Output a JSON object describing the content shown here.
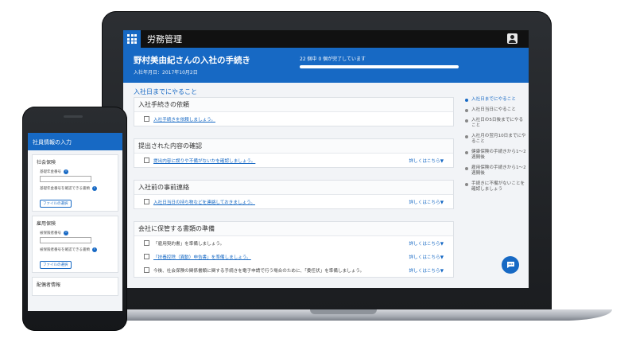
{
  "laptop": {
    "app_title": "労務管理",
    "banner_title": "野村美由紀さんの入社の手続き",
    "banner_subtitle": "入社年月日：2017年10月2日",
    "progress_text": "22 個中 0 個が完了しています",
    "progress_fraction": 1.0,
    "section_link": "入社日までにやること",
    "groups": [
      {
        "title": "入社手続きの依頼",
        "tasks": [
          {
            "text": "入社手続きを依頼しましょう。",
            "link": true,
            "detail": ""
          }
        ]
      },
      {
        "title": "提出された内容の確認",
        "tasks": [
          {
            "text": "提出内容に誤りや不備がないかを確認しましょう。",
            "link": true,
            "detail": "詳しくはこちら▼"
          }
        ]
      },
      {
        "title": "入社前の事前連絡",
        "tasks": [
          {
            "text": "入社日当日の持ち物などを連絡しておきましょう。",
            "link": true,
            "detail": "詳しくはこちら▼"
          }
        ]
      },
      {
        "title": "会社に保管する書類の準備",
        "tasks": [
          {
            "text": "「雇用契約書」を準備しましょう。",
            "link": false,
            "detail": "詳しくはこちら▼"
          },
          {
            "text": "「扶養控除（異動）申告書」を準備しましょう。",
            "link": true,
            "detail": "詳しくはこちら▼"
          },
          {
            "text": "今後、社会保険の関係書類に関する手続きを電子申請で行う場合のために、「委任状」を準備しましょう。",
            "link": false,
            "detail": "詳しくはこちら▼"
          }
        ]
      }
    ],
    "steps": [
      {
        "label": "入社日までにやること",
        "active": true
      },
      {
        "label": "入社日当日にやること",
        "active": false
      },
      {
        "label": "入社日の5日後までにやること",
        "active": false
      },
      {
        "label": "入社月の翌月10日までにやること",
        "active": false
      },
      {
        "label": "健康保険の手続きから1〜2週間後",
        "active": false
      },
      {
        "label": "雇用保険の手続きから1〜2週間後",
        "active": false
      },
      {
        "label": "手続きに不備がないことを確認しましょう",
        "active": false
      }
    ]
  },
  "phone": {
    "header_title": "社員情報の入力",
    "cards": [
      {
        "title": "社会保険",
        "fields": [
          "基礎年金番号",
          "基礎年金番号を確認できる書類"
        ],
        "file_button": "ファイルの選択"
      },
      {
        "title": "雇用保険",
        "fields": [
          "被保険者番号",
          "被保険者番号を確認できる書類"
        ],
        "file_button": "ファイルの選択"
      },
      {
        "title": "配偶者情報",
        "fields": [],
        "file_button": ""
      }
    ]
  },
  "icons": {
    "apps": "grid-apps-icon",
    "user": "user-icon",
    "chat": "chat-icon",
    "info": "info-icon"
  },
  "colors": {
    "accent": "#1769c4",
    "header": "#111111"
  }
}
